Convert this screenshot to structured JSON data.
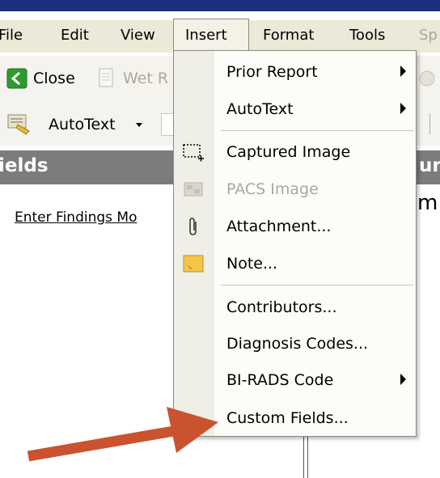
{
  "menubar": {
    "items": [
      {
        "label": "File"
      },
      {
        "label": "Edit"
      },
      {
        "label": "View"
      },
      {
        "label": "Insert"
      },
      {
        "label": "Format"
      },
      {
        "label": "Tools"
      },
      {
        "label": "Sp"
      }
    ]
  },
  "toolbar": {
    "close_label": "Close",
    "wet_read_label": "Wet R",
    "autotext_label": "AutoText"
  },
  "section": {
    "left_title": "ields",
    "right_title": "um"
  },
  "content": {
    "findings_link": "Enter Findings Mo",
    "right_text": "m"
  },
  "insert_menu": {
    "items": [
      {
        "label": "Prior Report",
        "submenu": true,
        "icon": ""
      },
      {
        "label": "AutoText",
        "submenu": true,
        "icon": ""
      },
      {
        "label": "Captured Image",
        "submenu": false,
        "icon": "capture-region-icon"
      },
      {
        "label": "PACS Image",
        "submenu": false,
        "icon": "pacs-image-icon",
        "disabled": true
      },
      {
        "label": "Attachment...",
        "submenu": false,
        "icon": "paperclip-icon"
      },
      {
        "label": "Note...",
        "submenu": false,
        "icon": "sticky-note-icon"
      },
      {
        "label": "Contributors...",
        "submenu": false,
        "icon": ""
      },
      {
        "label": "Diagnosis Codes...",
        "submenu": false,
        "icon": ""
      },
      {
        "label": "BI-RADS Code",
        "submenu": true,
        "icon": ""
      },
      {
        "label": "Custom Fields...",
        "submenu": false,
        "icon": ""
      }
    ]
  },
  "colors": {
    "title_strip": "#1b2f7c",
    "section_bar": "#7b7c7b",
    "annotation_arrow": "#c9532f",
    "close_icon_green": "#2e9b2e"
  }
}
